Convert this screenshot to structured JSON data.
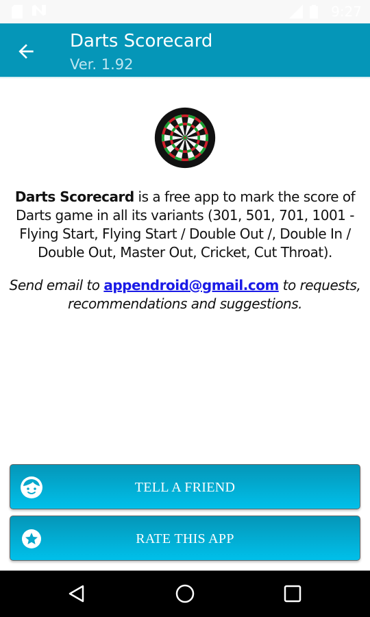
{
  "status_bar": {
    "time": "9:27",
    "network": "LTE",
    "icons": [
      "sd-card-icon",
      "n-notification-icon",
      "lte-signal-icon",
      "battery-charging-icon"
    ]
  },
  "app_bar": {
    "back_icon": "arrow-left-icon",
    "title": "Darts Scorecard",
    "subtitle": "Ver. 1.92"
  },
  "logo": {
    "icon": "dartboard-icon"
  },
  "description": {
    "app_name": "Darts Scorecard",
    "text": " is a free app to mark the score of Darts game in all its variants (301, 501, 701, 1001 - Flying Start, Flying Start / Double Out /, Double In / Double Out, Master Out, Cricket, Cut Throat)."
  },
  "contact": {
    "prefix": "Send email to ",
    "email": "appendroid@gmail.com",
    "suffix": " to requests, recommendations and suggestions."
  },
  "buttons": [
    {
      "label": "TELL A FRIEND",
      "icon": "face-icon"
    },
    {
      "label": "RATE THIS APP",
      "icon": "star-circle-icon"
    }
  ],
  "nav_bar": {
    "back": "back-triangle-icon",
    "home": "home-circle-icon",
    "recents": "recents-square-icon"
  },
  "colors": {
    "app_bar": "#0596b8",
    "button_top": "#0596b8",
    "button_bottom": "#00c0ea",
    "link": "#1a1ae6"
  }
}
